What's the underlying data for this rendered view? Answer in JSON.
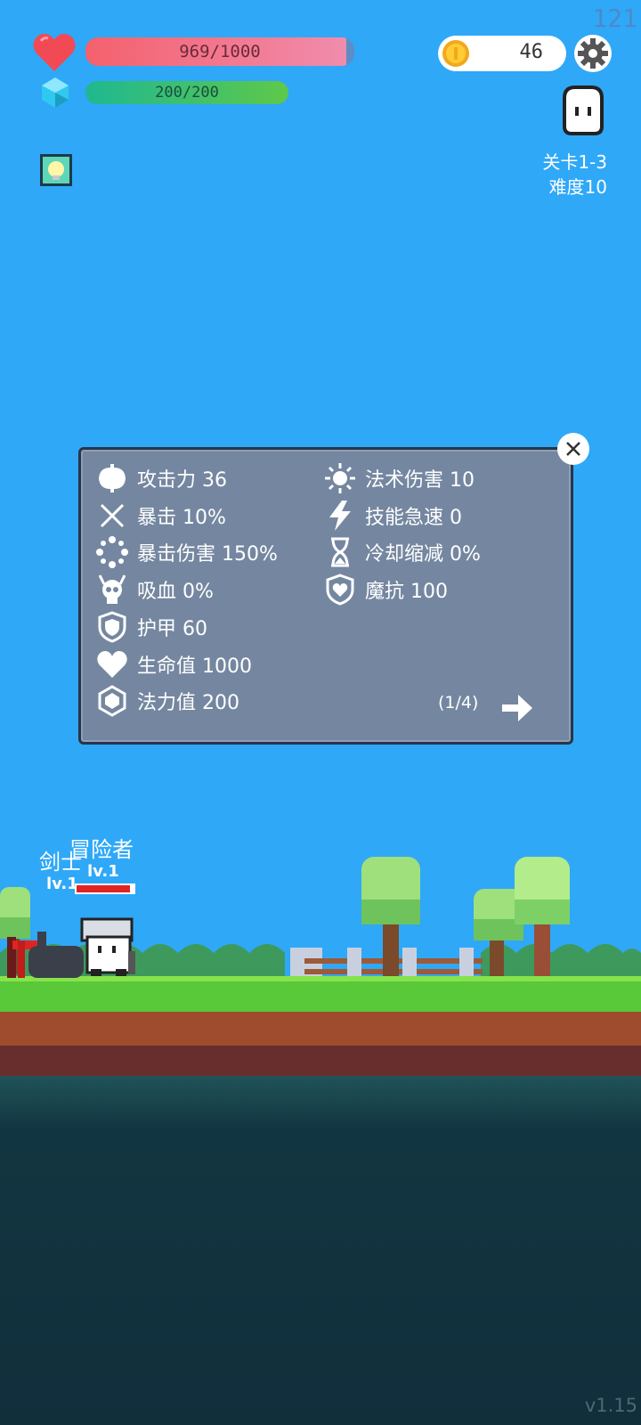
{
  "hud": {
    "fps": "121",
    "hp": {
      "text": "969/1000",
      "fraction": 0.969,
      "color": "#f4616d"
    },
    "mp": {
      "text": "200/200",
      "fraction": 1.0,
      "color": "#2fbf6f"
    },
    "coins": "46",
    "level": "关卡1-3",
    "difficulty": "难度10"
  },
  "stats_panel": {
    "left": [
      {
        "icon": "axe-icon",
        "text": "攻击力 36"
      },
      {
        "icon": "crit-icon",
        "text": "暴击 10%"
      },
      {
        "icon": "crit-damage-icon",
        "text": "暴击伤害 150%"
      },
      {
        "icon": "skull-icon",
        "text": "吸血 0%"
      },
      {
        "icon": "shield-icon",
        "text": "护甲 60"
      },
      {
        "icon": "heart-icon",
        "text": "生命值 1000"
      },
      {
        "icon": "crystal-icon",
        "text": "法力值 200"
      }
    ],
    "right": [
      {
        "icon": "sun-icon",
        "text": "法术伤害 10"
      },
      {
        "icon": "lightning-icon",
        "text": "技能急速 0"
      },
      {
        "icon": "hourglass-icon",
        "text": "冷却缩减 0%"
      },
      {
        "icon": "magic-shield-icon",
        "text": "魔抗 100"
      }
    ],
    "pager": "(1/4)"
  },
  "characters": {
    "enemy_name": "剑士",
    "enemy_level": "lv.1",
    "player_name": "冒险者",
    "player_level": "lv.1"
  },
  "version": "v1.15"
}
